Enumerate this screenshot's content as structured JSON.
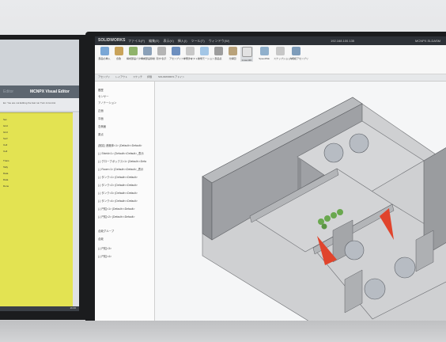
{
  "left_monitor": {
    "app_title": "MCNPX Visual Editor",
    "app_title_ghost": "Editor",
    "panel_text": "Ex: You are not Editing the fast run Turn A Control",
    "rows": [
      {
        "label": "Set"
      },
      {
        "label": "Grid"
      },
      {
        "label": "Grid"
      },
      {
        "label": "Surf"
      },
      {
        "label": "Cell"
      },
      {
        "label": "Cell"
      },
      {
        "label": "Trans"
      },
      {
        "label": "Tally"
      },
      {
        "label": "Data"
      },
      {
        "label": "Data"
      },
      {
        "label": "Done"
      }
    ],
    "clock": "16:46"
  },
  "right_monitor": {
    "app_logo": "SOLIDWORKS",
    "menu": [
      "ファイル(F)",
      "編集(E)",
      "表示(V)",
      "挿入(I)",
      "ツール(T)",
      "ウィンドウ(W)"
    ],
    "doc_title": "192.168.100.135",
    "doc_filename": "MCNPX.SLDASM",
    "ribbon": [
      {
        "label": "部品の挿入",
        "color": "#7aa7d6"
      },
      {
        "label": "合致",
        "color": "#c9a35a"
      },
      {
        "label": "構成部品パターン",
        "color": "#8fb36a"
      },
      {
        "label": "構成部品移動",
        "color": "#8aa0b8"
      },
      {
        "label": "隠す/表示",
        "color": "#b5b5b5"
      },
      {
        "label": "アセンブリフィーチャー",
        "color": "#6d8fbf"
      },
      {
        "label": "参照ジオメトリ",
        "color": "#c8c8c8"
      },
      {
        "label": "新規モーション",
        "color": "#a3c6e6"
      },
      {
        "label": "部品表",
        "color": "#9d9d9d"
      },
      {
        "label": "分解図",
        "color": "#b9a27a"
      },
      {
        "label": "Instant3D",
        "color": "#e2e2e2"
      },
      {
        "label": "SpeedPak",
        "color": "#90b0cc"
      },
      {
        "label": "スナップショット",
        "color": "#c7c7c7"
      },
      {
        "label": "大規模アセンブリ",
        "color": "#7e9cba"
      }
    ],
    "tabs": [
      "アセンブリ",
      "レイアウト",
      "スケッチ",
      "評価",
      "SOLIDWORKS アドイン"
    ],
    "tree": [
      "履歴",
      "センサー",
      "アノテーション",
      "正面",
      "平面",
      "右側面",
      "原点",
      "(固定) 遮蔽体<1> (Default<<Default>",
      "(-) Shield<1> (Default<<Default>_表示",
      "(-) グローブボックス<1> (Default<<Defa",
      "(-) Room<1> (Default<<Default>_表示",
      "(-) タンク<1> (Default<<Default>",
      "(-) タンク<2> (Default<<Default>",
      "(-) タンク<3> (Default<<Default>",
      "(-) タンク<4> (Default<<Default>",
      "(-) 円柱<1> (Default<<Default>",
      "(-) 円柱<2> (Default<<Default>",
      "合致グループ",
      "合致",
      "(-) 円柱<3>",
      "(-) 円柱<4>"
    ],
    "clock": "16:46"
  },
  "colors": {
    "wall_top": "#bdbfc2",
    "wall_side": "#8d8f93",
    "floor": "#d9dadc",
    "accent_red": "#e0442c",
    "plant_green": "#6aa84f"
  }
}
